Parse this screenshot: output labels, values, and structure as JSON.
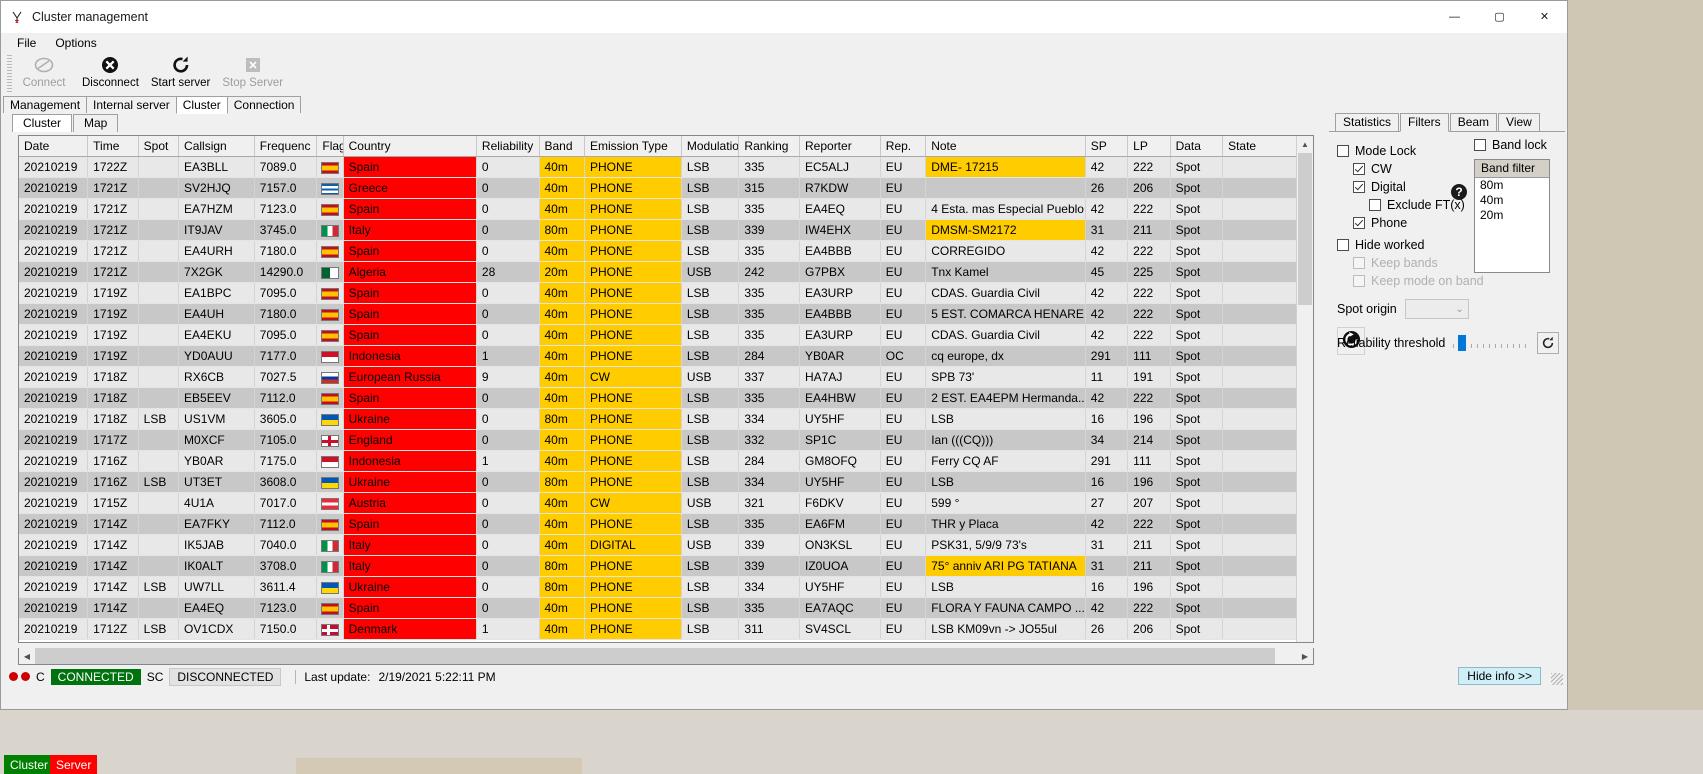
{
  "window": {
    "title": "Cluster management",
    "icon": "antenna-icon",
    "minimize": "—",
    "maximize": "▢",
    "close": "✕"
  },
  "menu": {
    "items": [
      "File",
      "Options"
    ]
  },
  "toolbar": {
    "buttons": [
      {
        "label": "Connect",
        "icon": "connect-icon",
        "disabled": true
      },
      {
        "label": "Disconnect",
        "icon": "disconnect-icon",
        "disabled": false
      },
      {
        "label": "Start server",
        "icon": "start-server-icon",
        "disabled": false
      },
      {
        "label": "Stop Server",
        "icon": "stop-server-icon",
        "disabled": true
      }
    ]
  },
  "main_tabs": {
    "items": [
      "Management",
      "Internal server",
      "Cluster",
      "Connection"
    ],
    "active": "Cluster"
  },
  "sub_tabs": {
    "items": [
      "Cluster",
      "Map"
    ],
    "active": "Cluster"
  },
  "grid": {
    "columns": [
      "Date",
      "Time",
      "Spot",
      "Callsign",
      "Frequenc",
      "Flag",
      "Country",
      "Reliability",
      "Band",
      "Emission Type",
      "Modulatior",
      "Ranking",
      "Reporter",
      "Rep.",
      "Note",
      "SP",
      "LP",
      "Data",
      "State"
    ],
    "rows": [
      {
        "date": "20210219",
        "time": "1722Z",
        "time_red": false,
        "spot": "",
        "callsign": "EA3BLL",
        "freq": "7089.0",
        "flag": "es",
        "country": "Spain",
        "reliability": "0",
        "band": "40m",
        "emission": "PHONE",
        "modulation": "LSB",
        "ranking": "335",
        "reporter": "EC5ALJ",
        "rep": "EU",
        "note": "DME- 17215",
        "note_hl": true,
        "sp": "42",
        "lp": "222",
        "data": "Spot",
        "state": ""
      },
      {
        "date": "20210219",
        "time": "1721Z",
        "time_red": true,
        "spot": "",
        "callsign": "SV2HJQ",
        "freq": "7157.0",
        "flag": "gr",
        "country": "Greece",
        "reliability": "0",
        "band": "40m",
        "emission": "PHONE",
        "modulation": "LSB",
        "ranking": "315",
        "reporter": "R7KDW",
        "rep": "EU",
        "note": "",
        "note_hl": false,
        "sp": "26",
        "lp": "206",
        "data": "Spot",
        "state": ""
      },
      {
        "date": "20210219",
        "time": "1721Z",
        "time_red": false,
        "spot": "",
        "callsign": "EA7HZM",
        "freq": "7123.0",
        "flag": "es",
        "country": "Spain",
        "reliability": "0",
        "band": "40m",
        "emission": "PHONE",
        "modulation": "LSB",
        "ranking": "335",
        "reporter": "EA4EQ",
        "rep": "EU",
        "note": "4 Esta. mas Especial Pueblo",
        "note_hl": false,
        "sp": "42",
        "lp": "222",
        "data": "Spot",
        "state": ""
      },
      {
        "date": "20210219",
        "time": "1721Z",
        "time_red": false,
        "spot": "",
        "callsign": "IT9JAV",
        "freq": "3745.0",
        "flag": "it",
        "country": "Italy",
        "reliability": "0",
        "band": "80m",
        "emission": "PHONE",
        "modulation": "LSB",
        "ranking": "339",
        "reporter": "IW4EHX",
        "rep": "EU",
        "note": "DMSM-SM2172",
        "note_hl": true,
        "sp": "31",
        "lp": "211",
        "data": "Spot",
        "state": ""
      },
      {
        "date": "20210219",
        "time": "1721Z",
        "time_red": false,
        "spot": "",
        "callsign": "EA4URH",
        "freq": "7180.0",
        "flag": "es",
        "country": "Spain",
        "reliability": "0",
        "band": "40m",
        "emission": "PHONE",
        "modulation": "LSB",
        "ranking": "335",
        "reporter": "EA4BBB",
        "rep": "EU",
        "note": "CORREGIDO",
        "note_hl": false,
        "sp": "42",
        "lp": "222",
        "data": "Spot",
        "state": ""
      },
      {
        "date": "20210219",
        "time": "1721Z",
        "time_red": true,
        "spot": "",
        "callsign": "7X2GK",
        "freq": "14290.0",
        "flag": "dz",
        "country": "Algeria",
        "reliability": "28",
        "band": "20m",
        "emission": "PHONE",
        "modulation": "USB",
        "ranking": "242",
        "reporter": "G7PBX",
        "rep": "EU",
        "note": "Tnx Kamel",
        "note_hl": false,
        "sp": "45",
        "lp": "225",
        "data": "Spot",
        "state": ""
      },
      {
        "date": "20210219",
        "time": "1719Z",
        "time_red": false,
        "spot": "",
        "callsign": "EA1BPC",
        "freq": "7095.0",
        "flag": "es",
        "country": "Spain",
        "reliability": "0",
        "band": "40m",
        "emission": "PHONE",
        "modulation": "LSB",
        "ranking": "335",
        "reporter": "EA3URP",
        "rep": "EU",
        "note": "CDAS. Guardia Civil",
        "note_hl": false,
        "sp": "42",
        "lp": "222",
        "data": "Spot",
        "state": ""
      },
      {
        "date": "20210219",
        "time": "1719Z",
        "time_red": false,
        "spot": "",
        "callsign": "EA4UH",
        "freq": "7180.0",
        "flag": "es",
        "country": "Spain",
        "reliability": "0",
        "band": "40m",
        "emission": "PHONE",
        "modulation": "LSB",
        "ranking": "335",
        "reporter": "EA4BBB",
        "rep": "EU",
        "note": "5 EST. COMARCA HENARE...",
        "note_hl": false,
        "sp": "42",
        "lp": "222",
        "data": "Spot",
        "state": ""
      },
      {
        "date": "20210219",
        "time": "1719Z",
        "time_red": false,
        "spot": "",
        "callsign": "EA4EKU",
        "freq": "7095.0",
        "flag": "es",
        "country": "Spain",
        "reliability": "0",
        "band": "40m",
        "emission": "PHONE",
        "modulation": "LSB",
        "ranking": "335",
        "reporter": "EA3URP",
        "rep": "EU",
        "note": "CDAS. Guardia Civil",
        "note_hl": false,
        "sp": "42",
        "lp": "222",
        "data": "Spot",
        "state": ""
      },
      {
        "date": "20210219",
        "time": "1719Z",
        "time_red": true,
        "spot": "",
        "callsign": "YD0AUU",
        "freq": "7177.0",
        "flag": "id",
        "country": "Indonesia",
        "reliability": "1",
        "band": "40m",
        "emission": "PHONE",
        "modulation": "LSB",
        "ranking": "284",
        "reporter": "YB0AR",
        "rep": "OC",
        "note": "cq europe, dx",
        "note_hl": false,
        "sp": "291",
        "lp": "111",
        "data": "Spot",
        "state": ""
      },
      {
        "date": "20210219",
        "time": "1718Z",
        "time_red": true,
        "spot": "",
        "callsign": "RX6CB",
        "freq": "7027.5",
        "flag": "ru",
        "country": "European Russia",
        "reliability": "9",
        "band": "40m",
        "emission": "CW",
        "modulation": "USB",
        "ranking": "337",
        "reporter": "HA7AJ",
        "rep": "EU",
        "note": "SPB 73'",
        "note_hl": false,
        "sp": "11",
        "lp": "191",
        "data": "Spot",
        "state": ""
      },
      {
        "date": "20210219",
        "time": "1718Z",
        "time_red": true,
        "spot": "",
        "callsign": "EB5EEV",
        "freq": "7112.0",
        "flag": "es",
        "country": "Spain",
        "reliability": "0",
        "band": "40m",
        "emission": "PHONE",
        "modulation": "LSB",
        "ranking": "335",
        "reporter": "EA4HBW",
        "rep": "EU",
        "note": "2 EST. EA4EPM Hermanda...",
        "note_hl": false,
        "sp": "42",
        "lp": "222",
        "data": "Spot",
        "state": ""
      },
      {
        "date": "20210219",
        "time": "1718Z",
        "time_red": false,
        "spot": "LSB",
        "callsign": "US1VM",
        "freq": "3605.0",
        "flag": "ua",
        "country": "Ukraine",
        "reliability": "0",
        "band": "80m",
        "emission": "PHONE",
        "modulation": "LSB",
        "ranking": "334",
        "reporter": "UY5HF",
        "rep": "EU",
        "note": "LSB",
        "note_hl": false,
        "sp": "16",
        "lp": "196",
        "data": "Spot",
        "state": ""
      },
      {
        "date": "20210219",
        "time": "1717Z",
        "time_red": true,
        "spot": "",
        "callsign": "M0XCF",
        "freq": "7105.0",
        "flag": "gb",
        "country": "England",
        "reliability": "0",
        "band": "40m",
        "emission": "PHONE",
        "modulation": "LSB",
        "ranking": "332",
        "reporter": "SP1C",
        "rep": "EU",
        "note": "Ian (((CQ)))",
        "note_hl": false,
        "sp": "34",
        "lp": "214",
        "data": "Spot",
        "state": ""
      },
      {
        "date": "20210219",
        "time": "1716Z",
        "time_red": true,
        "spot": "",
        "callsign": "YB0AR",
        "freq": "7175.0",
        "flag": "id",
        "country": "Indonesia",
        "reliability": "1",
        "band": "40m",
        "emission": "PHONE",
        "modulation": "LSB",
        "ranking": "284",
        "reporter": "GM8OFQ",
        "rep": "EU",
        "note": "Ferry CQ AF",
        "note_hl": false,
        "sp": "291",
        "lp": "111",
        "data": "Spot",
        "state": ""
      },
      {
        "date": "20210219",
        "time": "1716Z",
        "time_red": false,
        "spot": "LSB",
        "callsign": "UT3ET",
        "freq": "3608.0",
        "flag": "ua",
        "country": "Ukraine",
        "reliability": "0",
        "band": "80m",
        "emission": "PHONE",
        "modulation": "LSB",
        "ranking": "334",
        "reporter": "UY5HF",
        "rep": "EU",
        "note": "LSB",
        "note_hl": false,
        "sp": "16",
        "lp": "196",
        "data": "Spot",
        "state": ""
      },
      {
        "date": "20210219",
        "time": "1715Z",
        "time_red": true,
        "spot": "",
        "callsign": "4U1A",
        "freq": "7017.0",
        "flag": "at",
        "country": "Austria",
        "reliability": "0",
        "band": "40m",
        "emission": "CW",
        "modulation": "USB",
        "ranking": "321",
        "reporter": "F6DKV",
        "rep": "EU",
        "note": "599 °",
        "note_hl": false,
        "sp": "27",
        "lp": "207",
        "data": "Spot",
        "state": ""
      },
      {
        "date": "20210219",
        "time": "1714Z",
        "time_red": true,
        "spot": "",
        "callsign": "EA7FKY",
        "freq": "7112.0",
        "flag": "es",
        "country": "Spain",
        "reliability": "0",
        "band": "40m",
        "emission": "PHONE",
        "modulation": "LSB",
        "ranking": "335",
        "reporter": "EA6FM",
        "rep": "EU",
        "note": "THR y Placa",
        "note_hl": false,
        "sp": "42",
        "lp": "222",
        "data": "Spot",
        "state": ""
      },
      {
        "date": "20210219",
        "time": "1714Z",
        "time_red": false,
        "spot": "",
        "callsign": "IK5JAB",
        "freq": "7040.0",
        "flag": "it",
        "country": "Italy",
        "reliability": "0",
        "band": "40m",
        "emission": "DIGITAL",
        "modulation": "USB",
        "ranking": "339",
        "reporter": "ON3KSL",
        "rep": "EU",
        "note": "PSK31, 5/9/9  73's",
        "note_hl": false,
        "sp": "31",
        "lp": "211",
        "data": "Spot",
        "state": ""
      },
      {
        "date": "20210219",
        "time": "1714Z",
        "time_red": true,
        "spot": "",
        "callsign": "IK0ALT",
        "freq": "3708.0",
        "flag": "it",
        "country": "Italy",
        "reliability": "0",
        "band": "80m",
        "emission": "PHONE",
        "modulation": "LSB",
        "ranking": "339",
        "reporter": "IZ0UOA",
        "rep": "EU",
        "note": "75° anniv  ARI PG TATIANA",
        "note_hl": true,
        "sp": "31",
        "lp": "211",
        "data": "Spot",
        "state": ""
      },
      {
        "date": "20210219",
        "time": "1714Z",
        "time_red": true,
        "spot": "LSB",
        "callsign": "UW7LL",
        "freq": "3611.4",
        "flag": "ua",
        "country": "Ukraine",
        "reliability": "0",
        "band": "80m",
        "emission": "PHONE",
        "modulation": "LSB",
        "ranking": "334",
        "reporter": "UY5HF",
        "rep": "EU",
        "note": "LSB",
        "note_hl": false,
        "sp": "16",
        "lp": "196",
        "data": "Spot",
        "state": ""
      },
      {
        "date": "20210219",
        "time": "1714Z",
        "time_red": true,
        "spot": "",
        "callsign": "EA4EQ",
        "freq": "7123.0",
        "flag": "es",
        "country": "Spain",
        "reliability": "0",
        "band": "40m",
        "emission": "PHONE",
        "modulation": "LSB",
        "ranking": "335",
        "reporter": "EA7AQC",
        "rep": "EU",
        "note": "FLORA Y FAUNA  CAMPO ...",
        "note_hl": false,
        "sp": "42",
        "lp": "222",
        "data": "Spot",
        "state": ""
      },
      {
        "date": "20210219",
        "time": "1712Z",
        "time_red": false,
        "spot": "LSB",
        "callsign": "OV1CDX",
        "freq": "7150.0",
        "flag": "dk",
        "country": "Denmark",
        "reliability": "1",
        "band": "40m",
        "emission": "PHONE",
        "modulation": "LSB",
        "ranking": "311",
        "reporter": "SV4SCL",
        "rep": "EU",
        "note": "LSB KM09vn -> JO55ul",
        "note_hl": false,
        "sp": "26",
        "lp": "206",
        "data": "Spot",
        "state": ""
      }
    ]
  },
  "right_panel": {
    "tabs": [
      "Statistics",
      "Filters",
      "Beam",
      "View"
    ],
    "active_tab": "Filters",
    "mode_lock": {
      "label": "Mode Lock",
      "checked": false
    },
    "cw": {
      "label": "CW",
      "checked": true
    },
    "digital": {
      "label": "Digital",
      "checked": true
    },
    "exclude_ft": {
      "label": "Exclude FT(x)",
      "checked": false
    },
    "phone": {
      "label": "Phone",
      "checked": true
    },
    "hide_worked": {
      "label": "Hide worked",
      "checked": false
    },
    "keep_bands": {
      "label": "Keep bands",
      "checked": false,
      "disabled": true
    },
    "keep_mode_on_band": {
      "label": "Keep mode on band",
      "checked": false,
      "disabled": true
    },
    "spot_origin": {
      "label": "Spot origin",
      "value": ""
    },
    "refresh_icon": "refresh-icon",
    "help_icon": "help-icon",
    "band_lock": {
      "label": "Band lock",
      "checked": false
    },
    "band_filter": {
      "header": "Band filter",
      "items": [
        "80m",
        "40m",
        "20m"
      ]
    },
    "reliability_threshold": {
      "label": "Reliability threshold",
      "value": 5
    }
  },
  "status_bar": {
    "c_label": "C",
    "connected": "CONNECTED",
    "sc_label": "SC",
    "disconnected": "DISCONNECTED",
    "last_update_label": "Last update:",
    "last_update_value": "2/19/2021 5:22:11 PM",
    "hide_info": "Hide info >>"
  },
  "taskbar": {
    "items": [
      "Cluster",
      "Server"
    ]
  },
  "colors": {
    "red": "#fe0000",
    "yellow": "#ffcc00",
    "green": "#00720e",
    "accent": "#0078d7"
  }
}
